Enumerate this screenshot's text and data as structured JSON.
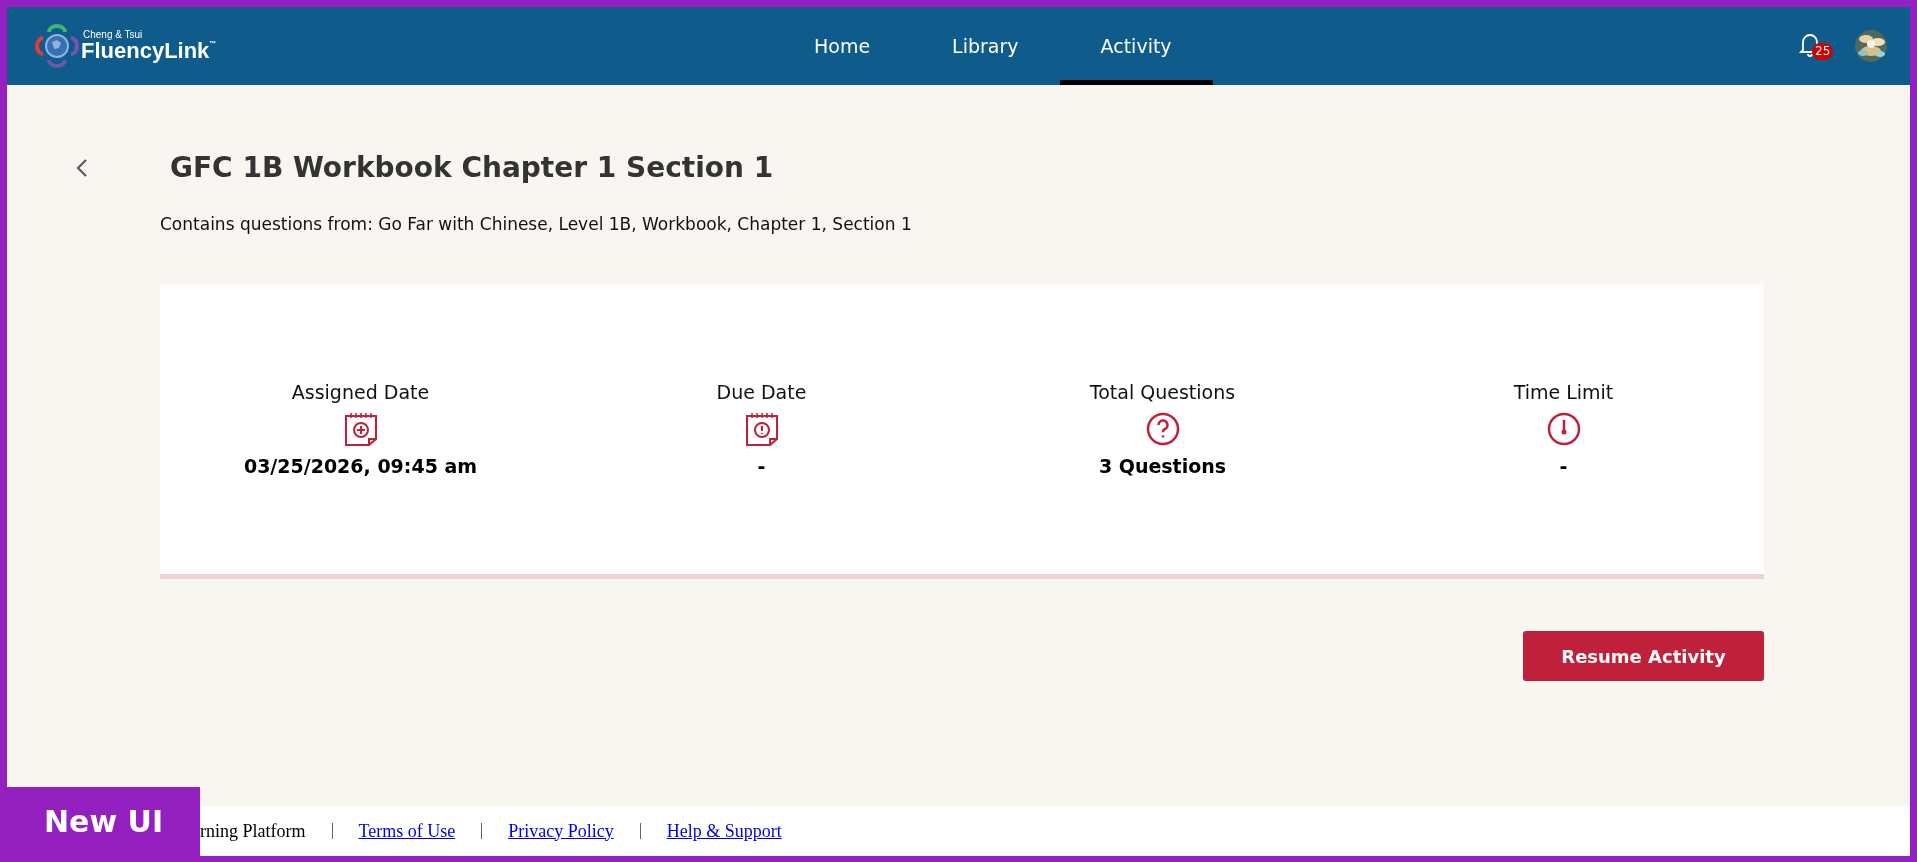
{
  "header": {
    "logo": {
      "small": "Cheng & Tsui",
      "name": "FluencyLink",
      "mark": "™"
    },
    "nav": [
      {
        "label": "Home",
        "selected": false
      },
      {
        "label": "Library",
        "selected": false
      },
      {
        "label": "Activity",
        "selected": true
      }
    ],
    "notifications": {
      "count": "25"
    }
  },
  "page": {
    "title": "GFC 1B Workbook Chapter 1 Section 1",
    "subtitle": "Contains questions from: Go Far with Chinese, Level 1B, Workbook, Chapter 1, Section 1"
  },
  "stats": [
    {
      "kind": "assigned",
      "label": "Assigned Date",
      "value": "03/25/2026, 09:45 am"
    },
    {
      "kind": "due",
      "label": "Due Date",
      "value": "-"
    },
    {
      "kind": "questions",
      "label": "Total Questions",
      "value": "3 Questions"
    },
    {
      "kind": "time",
      "label": "Time Limit",
      "value": "-"
    }
  ],
  "button": "Resume Activity",
  "footer": {
    "text": "rning Platform",
    "links": [
      "Terms of Use",
      "Privacy Policy",
      "Help & Support"
    ]
  },
  "badge": "New UI"
}
